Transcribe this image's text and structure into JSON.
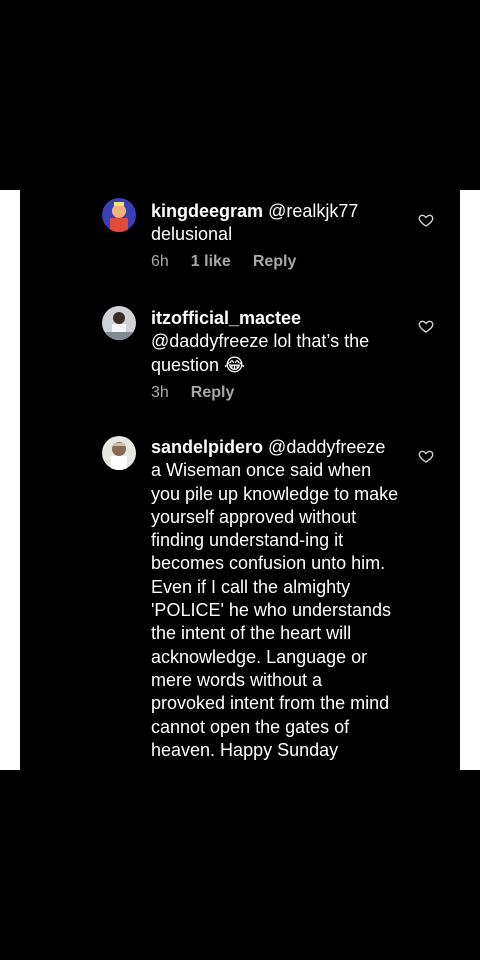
{
  "comments": [
    {
      "username": "kingdeegram",
      "mention": "@realkjk77",
      "text": "delusional",
      "time": "6h",
      "likes": "1 like",
      "reply": "Reply"
    },
    {
      "username": "itzofficial_mactee",
      "mention": "@daddyfreeze",
      "text": "lol that’s the question 😂",
      "time": "3h",
      "reply": "Reply"
    },
    {
      "username": "sandelpidero",
      "mention": "@daddyfreeze",
      "text": "a Wiseman once said when you pile up knowledge to make yourself approved without finding understand-ing it becomes confusion unto him. Even if I call the almighty 'POLICE' he who understands the intent of the heart will acknowledge. Language or mere words without a provoked intent from the mind cannot open the gates of heaven. Happy Sunday"
    }
  ],
  "icons": {
    "like": "heart-outline-icon",
    "avatar": "profile-avatar"
  },
  "colors": {
    "background": "#000000",
    "frame": "#ffffff",
    "text": "#ffffff",
    "meta": "#a8a8a8"
  }
}
